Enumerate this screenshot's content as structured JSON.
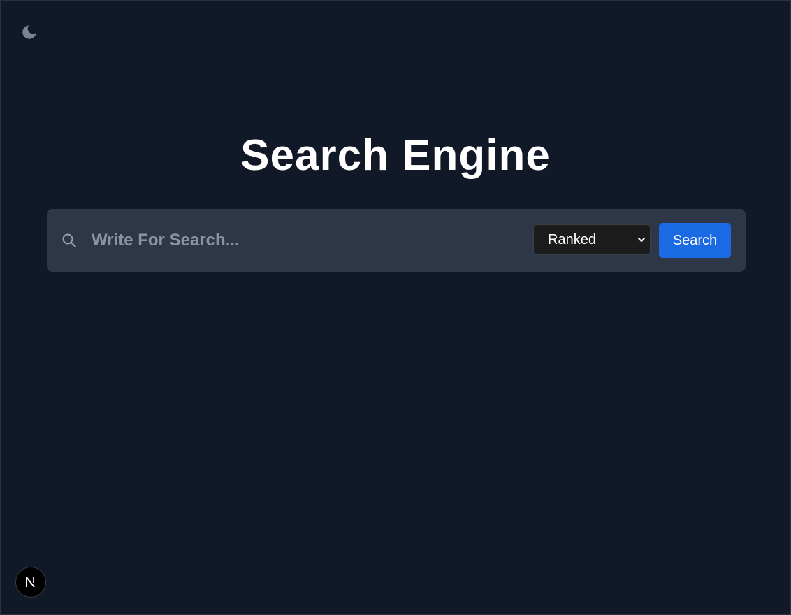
{
  "header": {
    "theme_toggle_icon": "moon-icon"
  },
  "main": {
    "title": "Search Engine"
  },
  "search": {
    "icon": "search-icon",
    "placeholder": "Write For Search...",
    "value": "",
    "mode_selected": "Ranked",
    "mode_icon": "chevron-down-icon",
    "button_label": "Search"
  },
  "footer": {
    "badge_icon": "nextjs-logo-icon"
  },
  "colors": {
    "background": "#111827",
    "search_bar": "#2e3748",
    "button": "#1a6be3",
    "select": "#1c1c1c"
  }
}
